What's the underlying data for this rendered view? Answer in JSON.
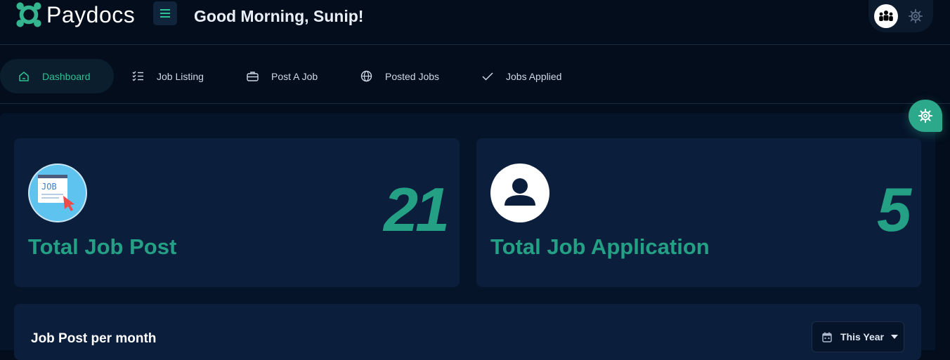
{
  "header": {
    "app_name": "Paydocs",
    "greeting": "Good Morning, Sunip!",
    "icons": {
      "logo": "paydocs-logo",
      "menu": "hamburger-icon",
      "avatar": "team-icon",
      "settings": "gear-icon"
    }
  },
  "nav": {
    "items": [
      {
        "label": "Dashboard",
        "icon": "home-icon",
        "active": true
      },
      {
        "label": "Job Listing",
        "icon": "checklist-icon"
      },
      {
        "label": "Post A Job",
        "icon": "briefcase-icon"
      },
      {
        "label": "Posted Jobs",
        "icon": "globe-icon"
      },
      {
        "label": "Jobs Applied",
        "icon": "check-icon"
      }
    ]
  },
  "stats": [
    {
      "label": "Total Job Post",
      "value": "21",
      "icon": "job-post-icon"
    },
    {
      "label": "Total Job Application",
      "value": "5",
      "icon": "user-icon"
    }
  ],
  "chart_section": {
    "title": "Job Post per month",
    "period_select": "This Year"
  },
  "colors": {
    "background": "#030d1c",
    "card": "#0b1f3d",
    "accent": "#24a185",
    "active_nav": "#2ec194"
  }
}
